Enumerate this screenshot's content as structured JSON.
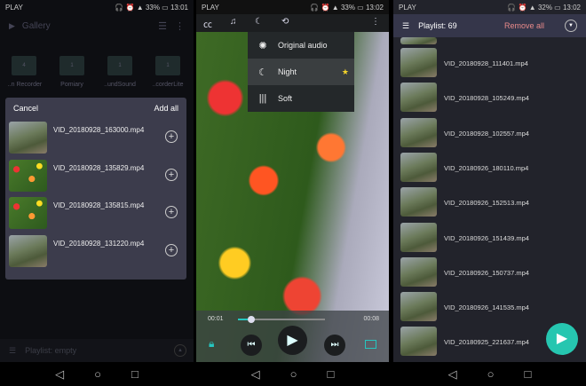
{
  "panel1": {
    "status": {
      "carrier": "PLAY",
      "battery": "33%",
      "time": "13:01"
    },
    "header": {
      "title": "Gallery"
    },
    "folders": [
      {
        "count": "4",
        "label": "..n Recorder"
      },
      {
        "count": "1",
        "label": "Pomiary"
      },
      {
        "count": "1",
        "label": "..undSound"
      },
      {
        "count": "1",
        "label": "..corderLite"
      }
    ],
    "dialog": {
      "cancel": "Cancel",
      "add_all": "Add all",
      "items": [
        "VID_20180928_163000.mp4",
        "VID_20180928_135829.mp4",
        "VID_20180928_135815.mp4",
        "VID_20180928_131220.mp4"
      ]
    },
    "playlist": "Playlist: empty"
  },
  "panel2": {
    "status": {
      "carrier": "PLAY",
      "battery": "33%",
      "time": "13:02"
    },
    "menu": [
      {
        "label": "Original audio",
        "icon": "sun-icon"
      },
      {
        "label": "Night",
        "icon": "moon-icon",
        "selected": true
      },
      {
        "label": "Soft",
        "icon": "soundwave-icon"
      }
    ],
    "elapsed": "00:01",
    "duration": "00:08",
    "progress_percent": 15,
    "accent": "#26c6c0"
  },
  "panel3": {
    "status": {
      "carrier": "PLAY",
      "battery": "32%",
      "time": "13:02"
    },
    "header": {
      "title": "Playlist: 69",
      "remove_all": "Remove all"
    },
    "items": [
      "VID_20180928_111401.mp4",
      "VID_20180928_105249.mp4",
      "VID_20180928_102557.mp4",
      "VID_20180926_180110.mp4",
      "VID_20180926_152513.mp4",
      "VID_20180926_151439.mp4",
      "VID_20180926_150737.mp4",
      "VID_20180926_141535.mp4",
      "VID_20180925_221637.mp4"
    ],
    "remove_color": "#e88a8a",
    "fab_color": "#26c6b0"
  }
}
